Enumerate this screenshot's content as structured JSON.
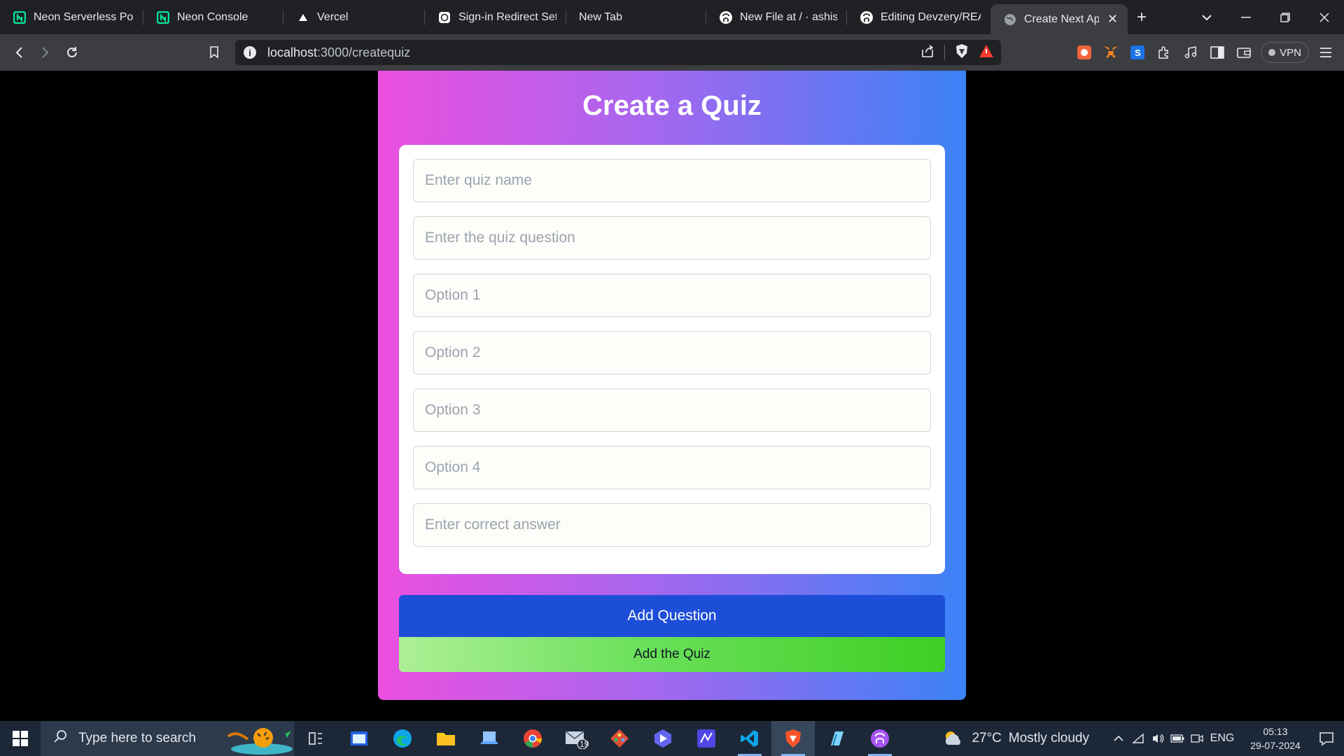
{
  "browser": {
    "tabs": [
      {
        "title": "Neon Serverless Post",
        "icon": "neon-icon"
      },
      {
        "title": "Neon Console",
        "icon": "neon-icon"
      },
      {
        "title": "Vercel",
        "icon": "vercel-icon"
      },
      {
        "title": "Sign-in Redirect Setu",
        "icon": "openai-icon"
      },
      {
        "title": "New Tab",
        "icon": ""
      },
      {
        "title": "New File at / · ashish",
        "icon": "github-icon"
      },
      {
        "title": "Editing Devzery/REAI",
        "icon": "github-icon"
      },
      {
        "title": "Create Next App",
        "icon": "globe-icon",
        "active": true
      }
    ],
    "address": {
      "host": "localhost",
      "path": ":3000/createquiz"
    },
    "vpn_label": "VPN"
  },
  "page": {
    "title": "Create a Quiz",
    "fields": {
      "quiz_name": "Enter quiz name",
      "question": "Enter the quiz question",
      "option1": "Option 1",
      "option2": "Option 2",
      "option3": "Option 3",
      "option4": "Option 4",
      "answer": "Enter correct answer"
    },
    "add_question_label": "Add Question",
    "add_quiz_label": "Add the Quiz",
    "colors": {
      "gradient_start": "#ec4fdf",
      "gradient_end": "#3b82f6",
      "add_question_bg": "#1d4ed8",
      "add_quiz_bg": "#4ccf2e"
    }
  },
  "taskbar": {
    "search_placeholder": "Type here to search",
    "mail_badge": "19",
    "weather": {
      "temp": "27°C",
      "condition": "Mostly cloudy"
    },
    "language": "ENG",
    "time": "05:13",
    "date": "29-07-2024"
  }
}
